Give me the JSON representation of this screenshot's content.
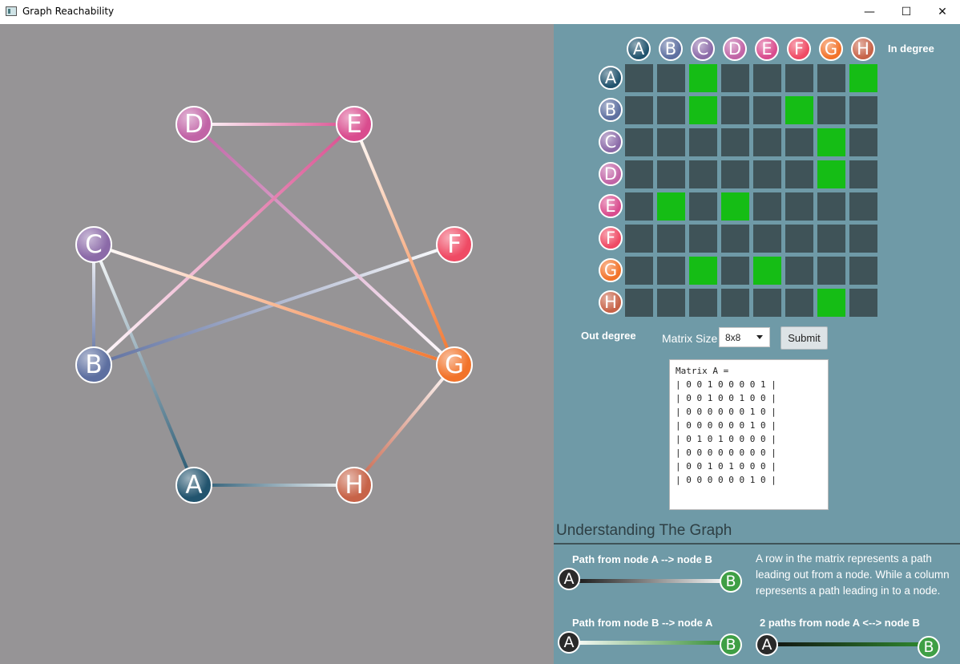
{
  "window": {
    "title": "Graph Reachability",
    "controls": {
      "minimize": "—",
      "maximize": "☐",
      "close": "✕"
    }
  },
  "nodes": [
    {
      "id": "A",
      "color": "#22546e"
    },
    {
      "id": "B",
      "color": "#5d6fa0"
    },
    {
      "id": "C",
      "color": "#8b6aa8"
    },
    {
      "id": "D",
      "color": "#c164a6"
    },
    {
      "id": "E",
      "color": "#d94c8e"
    },
    {
      "id": "F",
      "color": "#ef4a64"
    },
    {
      "id": "G",
      "color": "#f2732a"
    },
    {
      "id": "H",
      "color": "#c76348"
    }
  ],
  "matrix": {
    "column_headers": [
      "A",
      "B",
      "C",
      "D",
      "E",
      "F",
      "G",
      "H"
    ],
    "row_headers": [
      "A",
      "B",
      "C",
      "D",
      "E",
      "F",
      "G",
      "H"
    ],
    "in_degree_label": "In degree",
    "out_degree_label": "Out degree",
    "values": [
      [
        0,
        0,
        1,
        0,
        0,
        0,
        0,
        1
      ],
      [
        0,
        0,
        1,
        0,
        0,
        1,
        0,
        0
      ],
      [
        0,
        0,
        0,
        0,
        0,
        0,
        1,
        0
      ],
      [
        0,
        0,
        0,
        0,
        0,
        0,
        1,
        0
      ],
      [
        0,
        1,
        0,
        1,
        0,
        0,
        0,
        0
      ],
      [
        0,
        0,
        0,
        0,
        0,
        0,
        0,
        0
      ],
      [
        0,
        0,
        1,
        0,
        1,
        0,
        0,
        0
      ],
      [
        0,
        0,
        0,
        0,
        0,
        0,
        1,
        0
      ]
    ],
    "on_color": "#15bd15",
    "off_color": "#3f5358"
  },
  "controls": {
    "matrix_size_label": "Matrix Size",
    "matrix_size_value": "8x8",
    "submit_label": "Submit"
  },
  "matrix_text": "Matrix A =\n| 0 0 1 0 0 0 0 1 |\n| 0 0 1 0 0 1 0 0 |\n| 0 0 0 0 0 0 1 0 |\n| 0 0 0 0 0 0 1 0 |\n| 0 1 0 1 0 0 0 0 |\n| 0 0 0 0 0 0 0 0 |\n| 0 0 1 0 1 0 0 0 |\n| 0 0 0 0 0 0 1 0 |",
  "legend": {
    "section_title": "Understanding The Graph",
    "path_a_to_b": "Path from node A --> node B",
    "path_b_to_a": "Path from node B --> node A",
    "two_paths": "2 paths from node A <--> node B",
    "explanation": "A row in the matrix represents a path leading out from a node. While a column represents a path leading in to a node.",
    "node_a_label": "A",
    "node_b_label": "B"
  }
}
